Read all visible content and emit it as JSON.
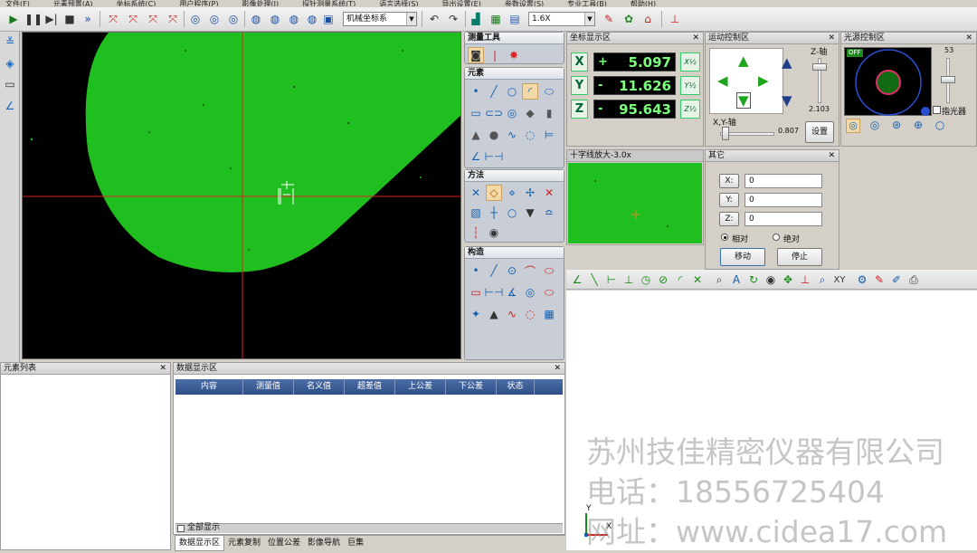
{
  "menu": [
    "文件(F)",
    "元素预置(A)",
    "坐标系统(C)",
    "用户程序(P)",
    "影像处理(I)",
    "探针测量系统(T)",
    "语言选择(S)",
    "导出设置(E)",
    "参数设置(S)",
    "专业工具(B)",
    "帮助(H)"
  ],
  "toolbar": {
    "coord_system": "机械坐标系",
    "zoom": "1.6X",
    "icons": [
      "run-icon",
      "pause-icon",
      "step-icon",
      "stop-icon",
      "fast-forward-icon",
      "probe-point-icon",
      "probe-cancel-icon",
      "probe-delete-icon",
      "probe-clear-icon",
      "probe-center-icon",
      "probe-plane-icon",
      "probe-circle-icon",
      "probe-line-icon",
      "probe-origin-icon",
      "probe-rotate-icon",
      "probe-offset-icon",
      "probe-align-icon",
      "save-icon",
      "undo-icon",
      "redo-icon",
      "report-icon",
      "excel-icon",
      "word-icon",
      "light-icon",
      "camera-icon",
      "home-icon",
      "axis-icon"
    ]
  },
  "measure_tools": {
    "title": "测量工具"
  },
  "elements_section": {
    "title": "元素"
  },
  "method_section": {
    "title": "方法"
  },
  "construct_section": {
    "title": "构造"
  },
  "coord_panel": {
    "title": "坐标显示区",
    "rows": [
      {
        "axis": "X",
        "sign": "+",
        "value": "5.097",
        "btn": "X½"
      },
      {
        "axis": "Y",
        "sign": "-",
        "value": "11.626",
        "btn": "Y½"
      },
      {
        "axis": "Z",
        "sign": "-",
        "value": "95.643",
        "btn": "Z½"
      }
    ]
  },
  "motion_panel": {
    "title": "运动控制区",
    "z_label": "Z-轴",
    "z_value": "2.103",
    "xy_label": "X,Y-轴",
    "xy_value": "0.807",
    "set_button": "设置"
  },
  "light_panel": {
    "title": "光源控制区",
    "off_label": "OFF",
    "level": "53",
    "pointer_label": "指光器",
    "level_fraction": 0.53
  },
  "crosshair_panel": {
    "title": "十字线放大-3.0x"
  },
  "other_panel": {
    "title": "其它",
    "x_label": "X:",
    "x_value": "0",
    "y_label": "Y:",
    "y_value": "0",
    "z_label": "Z:",
    "z_value": "0",
    "relative": "相对",
    "absolute": "绝对",
    "move_button": "移动",
    "stop_button": "停止"
  },
  "element_list": {
    "title": "元素列表"
  },
  "data_panel": {
    "title": "数据显示区",
    "columns": [
      "内容",
      "测量值",
      "名义值",
      "超差值",
      "上公差",
      "下公差",
      "状态"
    ],
    "show_all": "全部显示",
    "tabs": [
      "数据显示区",
      "元素复制",
      "位置公差",
      "影像导航",
      "巨集"
    ]
  },
  "graphic_axis": {
    "y": "Y",
    "x": "X"
  },
  "watermark": {
    "company": "苏州技佳精密仪器有限公司",
    "phone": "电话：18556725404",
    "site": "网址：www.cidea17.com"
  },
  "colors": {
    "green": "#1fbf1f",
    "crosshair": "#e02020",
    "table_header": "#3b5a93",
    "readout_text": "#7cff7c"
  }
}
